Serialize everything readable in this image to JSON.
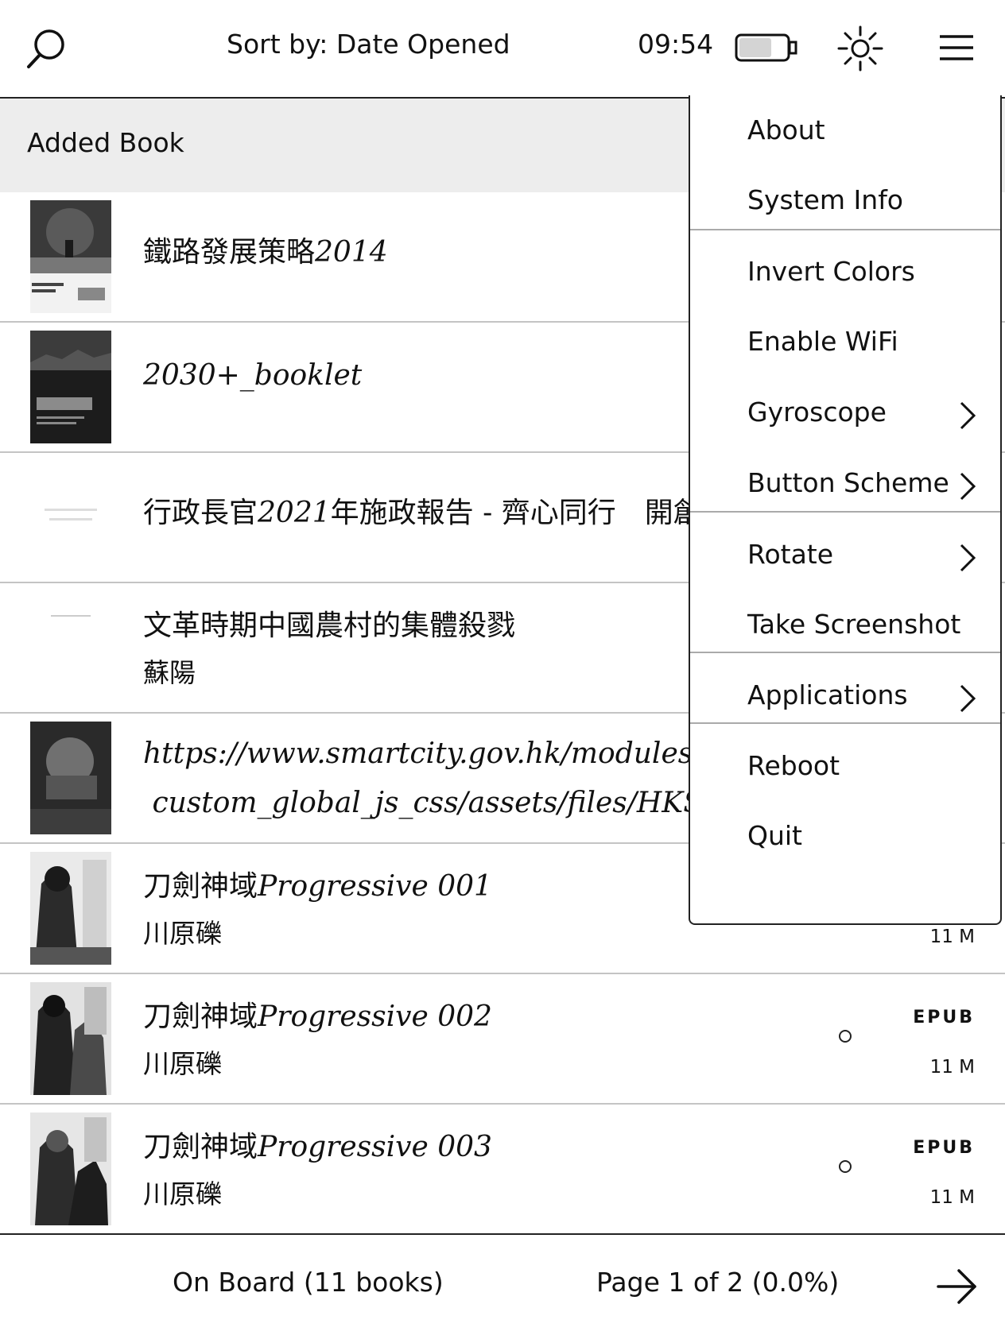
{
  "topbar": {
    "sort_label": "Sort by: Date Opened",
    "time": "09:54",
    "battery_icon": "battery-icon",
    "light_icon": "frontlight-icon"
  },
  "list": {
    "header": "Added Book",
    "books": [
      {
        "title_cjk": "鐵路發展策略",
        "title_latin": "2014",
        "author": ""
      },
      {
        "title_cjk": "",
        "title_latin": "2030+_booklet",
        "author": ""
      },
      {
        "title_cjk": "行政長官",
        "title_latin": "2021",
        "title_cjk2": "年施政報告 - 齊心同行　開創",
        "author": ""
      },
      {
        "title_cjk": "文革時期中國農村的集體殺戮",
        "author": "蘇陽"
      },
      {
        "title_line1": "https://www.smartcity.gov.hk/modules/cu",
        "title_line2": "custom_global_js_css/assets/files/HKSma",
        "author": ""
      },
      {
        "title_cjk": "刀劍神域",
        "title_latin": "Progressive 001",
        "author": "川原礫",
        "format": "",
        "size": "11 M"
      },
      {
        "title_cjk": "刀劍神域",
        "title_latin": "Progressive 002",
        "author": "川原礫",
        "format": "EPUB",
        "size": "11 M"
      },
      {
        "title_cjk": "刀劍神域",
        "title_latin": "Progressive 003",
        "author": "川原礫",
        "format": "EPUB",
        "size": "11 M"
      }
    ]
  },
  "footer": {
    "location": "On Board (11 books)",
    "page": "Page 1 of 2 (0.0%)"
  },
  "menu": {
    "items": [
      {
        "label": "About"
      },
      {
        "label": "System Info"
      },
      {
        "label": "Invert Colors"
      },
      {
        "label": "Enable WiFi"
      },
      {
        "label": "Gyroscope"
      },
      {
        "label": "Button Scheme"
      },
      {
        "label": "Rotate"
      },
      {
        "label": "Take Screenshot"
      },
      {
        "label": "Applications"
      },
      {
        "label": "Reboot"
      },
      {
        "label": "Quit"
      }
    ]
  }
}
